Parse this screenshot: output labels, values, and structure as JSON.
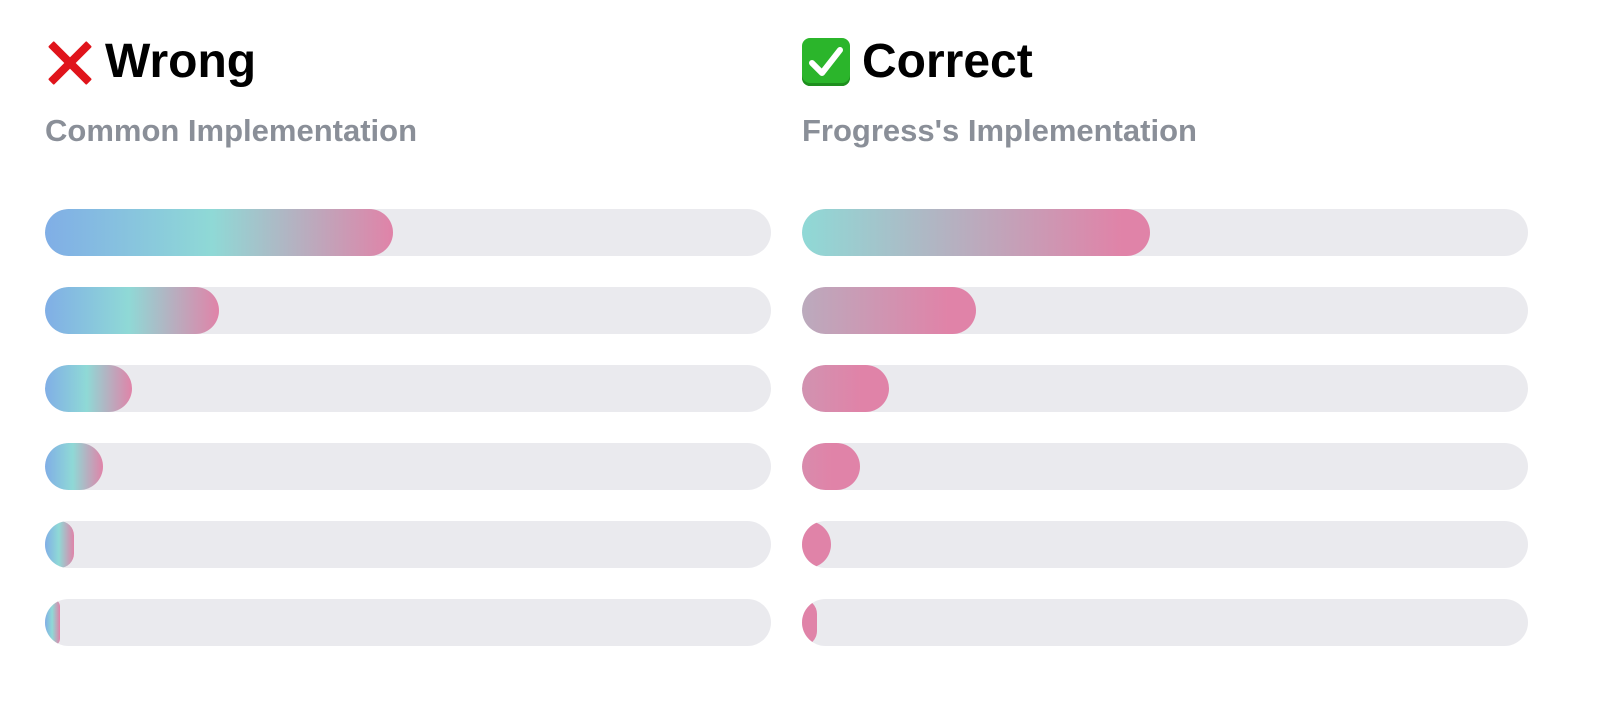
{
  "colors": {
    "track": "#eaeaee",
    "blue": "#80aee6",
    "teal": "#8fd9d6",
    "pink": "#e083a8",
    "subtitle": "#8a8f98",
    "wrong_icon": "#e0141b",
    "correct_icon": "#2bb52b"
  },
  "wrong": {
    "icon": "cross-mark-icon",
    "title": "Wrong",
    "subtitle": "Common Implementation",
    "progress": [
      0.48,
      0.24,
      0.12,
      0.08,
      0.04,
      0.02
    ]
  },
  "correct": {
    "icon": "check-mark-icon",
    "title": "Correct",
    "subtitle": "Frogress's Implementation",
    "progress": [
      0.48,
      0.24,
      0.12,
      0.08,
      0.04,
      0.02
    ]
  }
}
